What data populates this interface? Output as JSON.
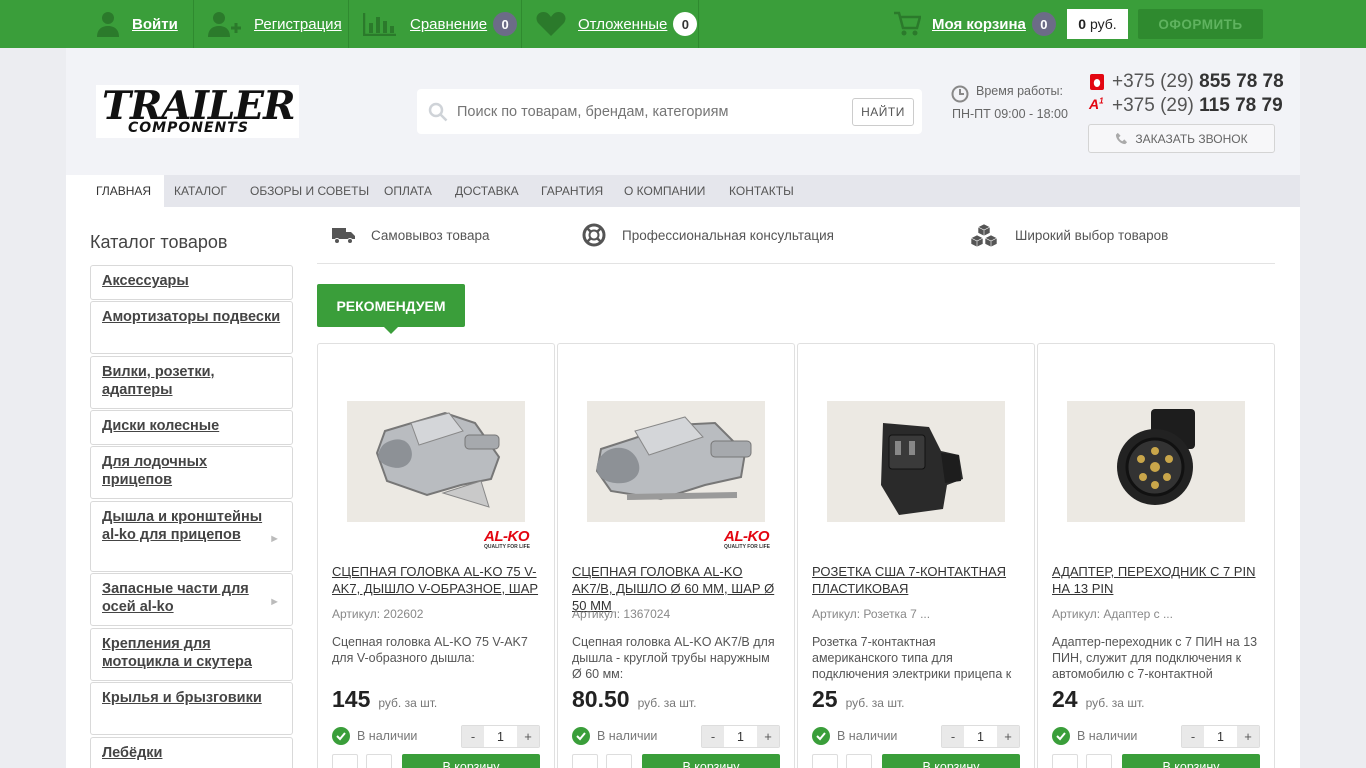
{
  "topbar": {
    "login_label": "Войти",
    "register_label": "Регистрация",
    "compare_label": "Сравнение",
    "compare_count": "0",
    "deferred_label": "Отложенные",
    "deferred_count": "0",
    "cart_label": "Моя корзина",
    "cart_count": "0",
    "cart_sum_value": "0",
    "cart_sum_currency": "руб.",
    "checkout_label": "ОФОРМИТЬ",
    "icons": [
      "user-icon",
      "add-user-icon",
      "bar-chart-icon",
      "heart-icon",
      "cart-icon"
    ]
  },
  "header": {
    "logo_line1": "TRAILER",
    "logo_line2": "COMPONENTS",
    "search_placeholder": "Поиск по товарам, брендам, категориям",
    "search_button": "НАЙТИ",
    "work_label": "Время работы:",
    "work_hours": "ПН-ПТ 09:00 - 18:00",
    "phone1_prefix": "+375 (29)",
    "phone1_number": "855 78 78",
    "phone2_prefix": "+375 (29)",
    "phone2_number": "115 78 79",
    "callback_label": "ЗАКАЗАТЬ ЗВОНОК"
  },
  "nav": {
    "items": [
      "ГЛАВНАЯ",
      "КАТАЛОГ",
      "ОБЗОРЫ И СОВЕТЫ",
      "ОПЛАТА",
      "ДОСТАВКА",
      "ГАРАНТИЯ",
      "О КОМПАНИИ",
      "КОНТАКТЫ"
    ],
    "active": "ГЛАВНАЯ"
  },
  "sidebar": {
    "title": "Каталог товаров",
    "categories": [
      "Аксессуары",
      "Амортизаторы подвески",
      "Вилки, розетки, адаптеры",
      "Диски колесные",
      "Для лодочных прицепов",
      "Дышла и кронштейны al-ko для прицепов",
      "Запасные части для осей al-ko",
      "Крепления для мотоцикла и скутера",
      "Крылья и брызговики",
      "Лебёдки"
    ]
  },
  "features": [
    "Самовывоз товара",
    "Профессиональная консультация",
    "Широкий выбор товаров"
  ],
  "recommend_label": "РЕКОМЕНДУЕМ",
  "products": [
    {
      "title": "Сцепная головка AL-KO 75 V-AK7, дышло V-образное, шар",
      "article": "Артикул: 202602",
      "desc": "Сцепная головка AL-KO 75 V-AK7 для V-образного дышла:",
      "price": "145",
      "unit": "руб. за шт.",
      "stock": "В наличии",
      "qty": "1",
      "brand": "AL-KO",
      "brand_tag": "QUALITY FOR LIFE",
      "cart_label": "В корзину"
    },
    {
      "title": "Сцепная головка AL-KO AK7/B, дышло Ø 60 мм, шар Ø 50 мм",
      "article": "Артикул: 1367024",
      "desc": "Сцепная головка AL-KO AK7/B для дышла - круглой трубы наружным Ø 60 мм:",
      "price": "80.50",
      "unit": "руб. за шт.",
      "stock": "В наличии",
      "qty": "1",
      "brand": "AL-KO",
      "brand_tag": "QUALITY FOR LIFE",
      "cart_label": "В корзину"
    },
    {
      "title": "Розетка США 7-контактная пластиковая",
      "article": "Артикул: Розетка 7 ...",
      "desc": "Розетка 7-контактная американского типа для подключения электрики прицепа к",
      "price": "25",
      "unit": "руб. за шт.",
      "stock": "В наличии",
      "qty": "1",
      "brand": "",
      "brand_tag": "",
      "cart_label": "В корзину"
    },
    {
      "title": "Адаптер, переходник с 7 PIN на 13 PIN",
      "article": "Артикул: Адаптер с ...",
      "desc": "Адаптер-переходник с 7 ПИН на 13 ПИН, служит для подключения к автомобилю с 7-контактной",
      "price": "24",
      "unit": "руб. за шт.",
      "stock": "В наличии",
      "qty": "1",
      "brand": "",
      "brand_tag": "",
      "cart_label": "В корзину"
    }
  ],
  "colors": {
    "accent": "#3a9e3a",
    "badge": "#6c6c87",
    "mts_red": "#e30611"
  }
}
